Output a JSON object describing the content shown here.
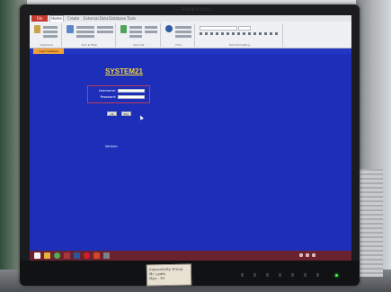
{
  "app": {
    "title": "SYSTEM21",
    "document_tab": "Login Systems",
    "version_label": "Version:"
  },
  "ribbon": {
    "file_tab": "File",
    "home_tab": "Home",
    "tabs": [
      "Create",
      "External Data",
      "Database Tools"
    ],
    "groups": [
      "Clipboard",
      "Sort & Filter",
      "Records",
      "Find",
      "Text Formatting"
    ]
  },
  "login": {
    "username_label": "Username:",
    "password_label": "Password:",
    "username_value": "",
    "password_value": "",
    "ok_button": "OK",
    "exit_button": "Exit"
  },
  "monitor": {
    "brand": "ViewSonic"
  },
  "sticker": {
    "lines": [
      "Interactivity Group",
      "Mr. Lewis",
      "Mon - Fri"
    ]
  },
  "taskbar": {
    "apps": [
      "start-button-icon",
      "file-explorer-icon",
      "chrome-icon",
      "access-icon",
      "word-icon",
      "opera-icon",
      "powerpoint-icon",
      "settings-icon"
    ],
    "clock_time": "",
    "clock_date": ""
  },
  "colors": {
    "screen_background": "#1d2fb8",
    "title_color": "#f3d23a",
    "login_border": "#ba3e56",
    "taskbar": "#6a2230",
    "file_tab": "#c43a2e",
    "document_tab": "#f2a13a"
  }
}
